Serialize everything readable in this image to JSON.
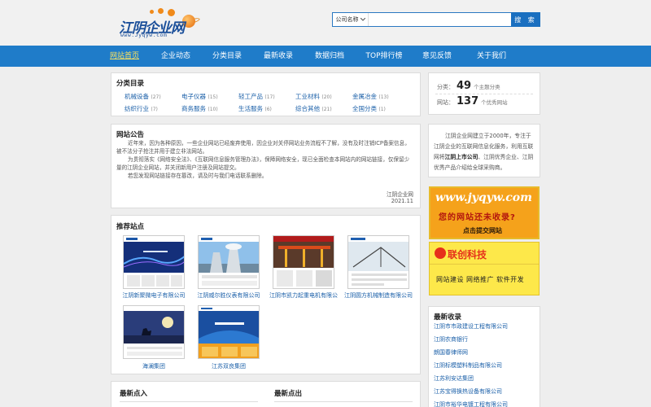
{
  "header": {
    "logo_text": "江阴企业网",
    "logo_url": "www.Jyqyw.com",
    "search": {
      "select_value": "公司名称",
      "input_value": "",
      "button_label": "搜 索"
    }
  },
  "nav": {
    "items": [
      {
        "label": "网站首页",
        "active": true
      },
      {
        "label": "企业动态"
      },
      {
        "label": "分类目录"
      },
      {
        "label": "最新收录"
      },
      {
        "label": "数据归档"
      },
      {
        "label": "TOP排行榜"
      },
      {
        "label": "意见反馈"
      },
      {
        "label": "关于我们"
      }
    ]
  },
  "categories": {
    "title": "分类目录",
    "items": [
      {
        "label": "机械设备",
        "count": "(27)"
      },
      {
        "label": "电子仪器",
        "count": "(15)"
      },
      {
        "label": "轻工产品",
        "count": "(17)"
      },
      {
        "label": "工业材料",
        "count": "(20)"
      },
      {
        "label": "金属冶金",
        "count": "(13)"
      },
      {
        "label": "纺织行业",
        "count": "(7)"
      },
      {
        "label": "商务服务",
        "count": "(10)"
      },
      {
        "label": "生活服务",
        "count": "(6)"
      },
      {
        "label": "综合其他",
        "count": "(21)"
      },
      {
        "label": "全国分类",
        "count": "(1)"
      }
    ]
  },
  "notice": {
    "title": "网站公告",
    "paragraphs": [
      "近年来，因为各种原因，一些企业网站已经废弃使用，因企业对关停网站业务流程不了解，没有及时注销ICP备案信息，被不法分子抢注并用于建立非法网站。",
      "为贯彻落实《网络安全法》、《互联网信息服务管理办法》，保障网络安全，现已全面检查本网站内的网站链接，仅保留少量的江阴企业网站，并关闭新用户注册及网站提交。",
      "若您发现网站链接存在篡改，请及时与我们电话联系删除。"
    ],
    "sign": "江阴企业网",
    "date": "2021.11"
  },
  "recommended": {
    "title": "推荐站点",
    "sites": [
      {
        "name": "江阴新聚微电子有限公司"
      },
      {
        "name": "江阴威尔胜仪表有限公司"
      },
      {
        "name": "江阴市凯力起重电机有限公"
      },
      {
        "name": "江阴圆方机械制造有限公司"
      },
      {
        "name": "海澜集团"
      },
      {
        "name": "江苏双良集团"
      }
    ]
  },
  "stats": {
    "category_label": "分类：",
    "category_count": "49",
    "category_unit": "个主题分类",
    "site_label": "网站：",
    "site_count": "137",
    "site_unit": "个优秀网站"
  },
  "intro": {
    "text_1": "江阴企业网建立于2000年，专注于江阴企业的互联网信息化服务，利用互联网将",
    "bold_1": "江阴上市公司",
    "text_2": "、江阴优秀企业、江阴优秀产品介绍给全球采购商。"
  },
  "ads": {
    "ad1_url": "www.jyqyw.com",
    "ad1_text": "您的网站还未收录?",
    "ad1_sub": "点击提交网站",
    "ad2_name": "联创科技",
    "ad2_text": "网站建设  网络推广  软件开发"
  },
  "newest": {
    "title": "最新收录",
    "items": [
      "江阴市市政建设工程有限公司",
      "江阴农商银行",
      "朗国春律师网",
      "江阴标模塑料制品有限公司",
      "江苏利安达集团",
      "江苏宝得换热设备有限公司",
      "江阴市裕华电镀工程有限公司"
    ]
  },
  "bottom": {
    "latest_in": "最新点入",
    "latest_out": "最新点出"
  },
  "colors": {
    "nav_bg": "#1f7cc9",
    "nav_active": "#ffe35c",
    "link": "#1a5fa8"
  }
}
